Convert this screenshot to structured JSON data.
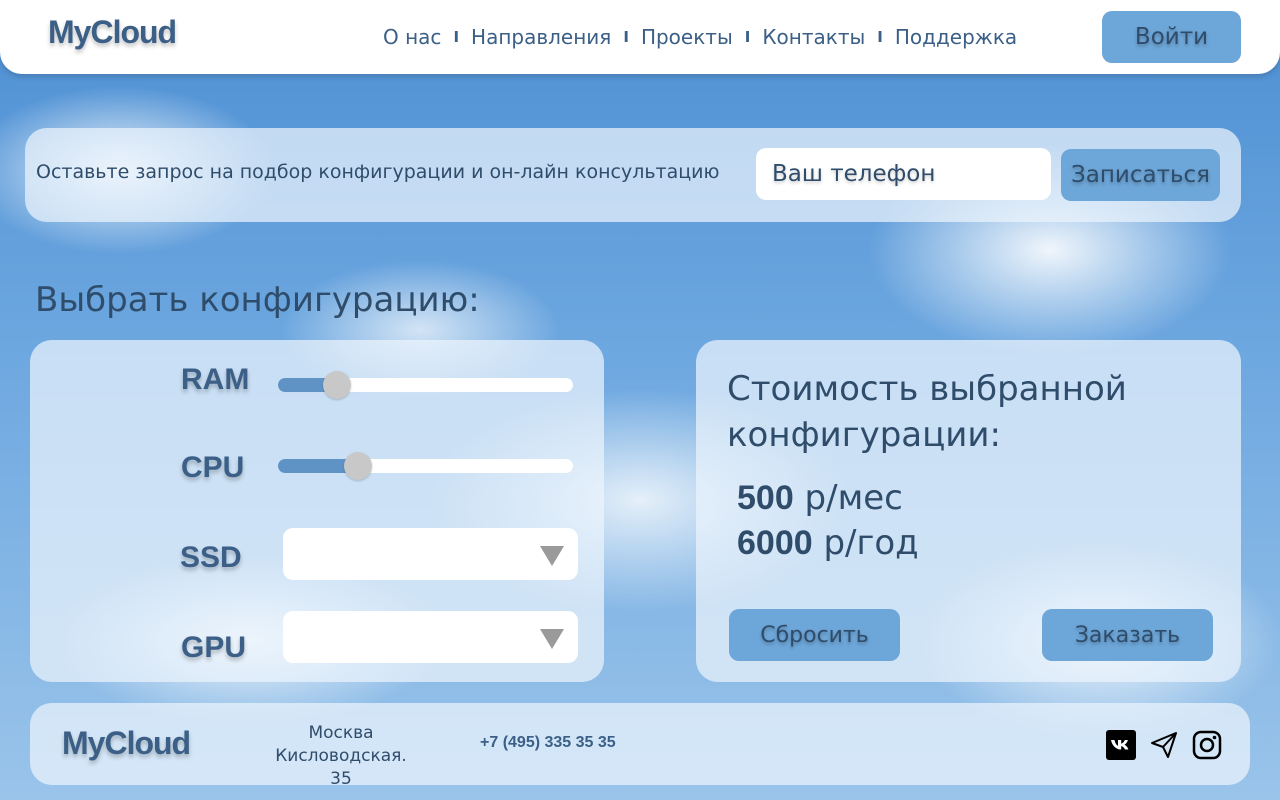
{
  "header": {
    "logo": "MyCloud",
    "nav": [
      "О нас",
      "Направления",
      "Проекты",
      "Контакты",
      "Поддержка"
    ],
    "nav_separator": "I",
    "login_label": "Войти"
  },
  "request": {
    "text": "Оставьте запрос на подбор конфигурации и он-лайн консультацию",
    "phone_placeholder": "Ваш телефон",
    "submit_label": "Записаться"
  },
  "config": {
    "title": "Выбрать конфигурацию:",
    "ram": {
      "label": "RAM",
      "value_fraction": 0.2
    },
    "cpu": {
      "label": "CPU",
      "value_fraction": 0.27
    },
    "ssd": {
      "label": "SSD",
      "selected": ""
    },
    "gpu": {
      "label": "GPU",
      "selected": ""
    }
  },
  "price": {
    "title": "Стоимость выбранной конфигурации:",
    "monthly_value": "500",
    "monthly_unit": " р/мес",
    "yearly_value": "6000",
    "yearly_unit": " р/год",
    "reset_label": "Сбросить",
    "order_label": "Заказать"
  },
  "footer": {
    "logo": "MyCloud",
    "city": "Москва",
    "address": "Кисловодская. 35",
    "phone": "+7 (495) 335 35 35",
    "social_icons": [
      "vk-icon",
      "telegram-icon",
      "instagram-icon"
    ]
  },
  "colors": {
    "accent": "#6da6d8",
    "text": "#2f4d6b",
    "logo": "#3b5f86"
  }
}
